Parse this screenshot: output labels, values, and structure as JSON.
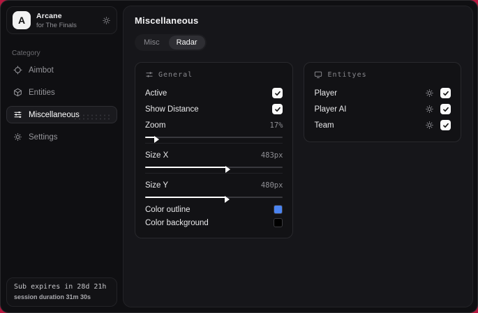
{
  "backdrop_color": "#b5173f",
  "sidebar": {
    "app": {
      "initial": "A",
      "name": "Arcane",
      "subtitle": "for The Finals"
    },
    "category_label": "Category",
    "items": [
      {
        "label": "Aimbot"
      },
      {
        "label": "Entities"
      },
      {
        "label": "Miscellaneous"
      },
      {
        "label": "Settings"
      }
    ],
    "subscription": {
      "expires": "Sub expires in 28d 21h",
      "session": "session duration 31m 30s"
    }
  },
  "main": {
    "title": "Miscellaneous",
    "tabs": [
      {
        "label": "Misc"
      },
      {
        "label": "Radar"
      }
    ],
    "general": {
      "title": "General",
      "toggles": [
        {
          "label": "Active",
          "checked": true
        },
        {
          "label": "Show Distance",
          "checked": true
        }
      ],
      "sliders": [
        {
          "label": "Zoom",
          "value": "17%",
          "fill": "7%"
        },
        {
          "label": "Size X",
          "value": "483px",
          "fill": "59%"
        },
        {
          "label": "Size Y",
          "value": "480px",
          "fill": "58%"
        }
      ],
      "colors": [
        {
          "label": "Color outline",
          "hex": "#4b84f1"
        },
        {
          "label": "Color background",
          "hex": "#000000"
        }
      ]
    },
    "entities": {
      "title": "Entityes",
      "rows": [
        {
          "label": "Player",
          "checked": true
        },
        {
          "label": "Player AI",
          "checked": true
        },
        {
          "label": "Team",
          "checked": true
        }
      ]
    }
  }
}
